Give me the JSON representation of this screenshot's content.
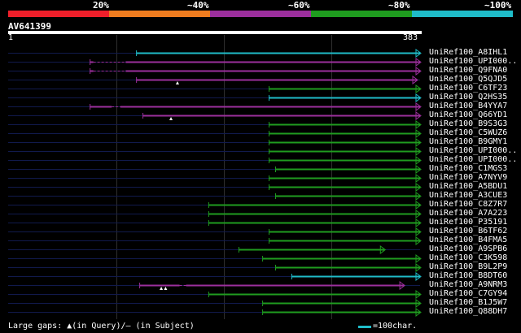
{
  "legend": {
    "labels": [
      "20%",
      "~40%",
      "~60%",
      "~80%",
      "~100%"
    ],
    "colors": [
      "#ef1f2a",
      "#ef7c1f",
      "#9c2f9d",
      "#1f9c1f",
      "#1fbcc9"
    ]
  },
  "query": {
    "title": "AV641399",
    "start_label": "1",
    "end_label": "383",
    "length": 383
  },
  "hits": [
    {
      "name": "UniRef100_A8IHL1",
      "color": "cyan",
      "start": 120,
      "end": 383,
      "gap_start": null,
      "gap_end": null,
      "markers": []
    },
    {
      "name": "UniRef100_UPI000..",
      "color": "purple",
      "start": 77,
      "end": 383,
      "gap_start": 80,
      "gap_end": 110,
      "markers": []
    },
    {
      "name": "UniRef100_Q9FNA0",
      "color": "purple",
      "start": 77,
      "end": 383,
      "gap_start": 80,
      "gap_end": 110,
      "markers": []
    },
    {
      "name": "UniRef100_Q5QJD5",
      "color": "purple",
      "start": 120,
      "end": 380,
      "gap_start": null,
      "gap_end": null,
      "markers": [
        158
      ]
    },
    {
      "name": "UniRef100_C6TF23",
      "color": "green",
      "start": 243,
      "end": 383,
      "gap_start": null,
      "gap_end": null,
      "markers": []
    },
    {
      "name": "UniRef100_Q2HS35",
      "color": "cyan",
      "start": 243,
      "end": 383,
      "gap_start": null,
      "gap_end": null,
      "markers": []
    },
    {
      "name": "UniRef100_B4YYA7",
      "color": "purple",
      "start": 77,
      "end": 383,
      "gap_start": 97,
      "gap_end": 105,
      "markers": []
    },
    {
      "name": "UniRef100_Q66YD1",
      "color": "purple",
      "start": 126,
      "end": 383,
      "gap_start": null,
      "gap_end": null,
      "markers": [
        152
      ]
    },
    {
      "name": "UniRef100_B9S3G3",
      "color": "green",
      "start": 243,
      "end": 383,
      "gap_start": null,
      "gap_end": null,
      "markers": []
    },
    {
      "name": "UniRef100_C5WUZ6",
      "color": "green",
      "start": 243,
      "end": 383,
      "gap_start": null,
      "gap_end": null,
      "markers": []
    },
    {
      "name": "UniRef100_B9GMY1",
      "color": "green",
      "start": 243,
      "end": 383,
      "gap_start": null,
      "gap_end": null,
      "markers": []
    },
    {
      "name": "UniRef100_UPI000..",
      "color": "green",
      "start": 243,
      "end": 383,
      "gap_start": null,
      "gap_end": null,
      "markers": []
    },
    {
      "name": "UniRef100_UPI000..",
      "color": "green",
      "start": 243,
      "end": 383,
      "gap_start": null,
      "gap_end": null,
      "markers": []
    },
    {
      "name": "UniRef100_C1MGS3",
      "color": "green",
      "start": 249,
      "end": 383,
      "gap_start": null,
      "gap_end": null,
      "markers": []
    },
    {
      "name": "UniRef100_A7NYV9",
      "color": "green",
      "start": 243,
      "end": 383,
      "gap_start": null,
      "gap_end": null,
      "markers": []
    },
    {
      "name": "UniRef100_A5BDU1",
      "color": "green",
      "start": 243,
      "end": 383,
      "gap_start": null,
      "gap_end": null,
      "markers": []
    },
    {
      "name": "UniRef100_A3CUE3",
      "color": "green",
      "start": 249,
      "end": 383,
      "gap_start": null,
      "gap_end": null,
      "markers": []
    },
    {
      "name": "UniRef100_C8Z7R7",
      "color": "green",
      "start": 187,
      "end": 383,
      "gap_start": null,
      "gap_end": null,
      "markers": []
    },
    {
      "name": "UniRef100_A7A223",
      "color": "green",
      "start": 187,
      "end": 383,
      "gap_start": null,
      "gap_end": null,
      "markers": []
    },
    {
      "name": "UniRef100_P35191",
      "color": "green",
      "start": 187,
      "end": 383,
      "gap_start": null,
      "gap_end": null,
      "markers": []
    },
    {
      "name": "UniRef100_B6TF62",
      "color": "green",
      "start": 243,
      "end": 383,
      "gap_start": null,
      "gap_end": null,
      "markers": []
    },
    {
      "name": "UniRef100_B4FMA5",
      "color": "green",
      "start": 243,
      "end": 383,
      "gap_start": null,
      "gap_end": null,
      "markers": []
    },
    {
      "name": "UniRef100_A9SPB6",
      "color": "green",
      "start": 215,
      "end": 350,
      "gap_start": null,
      "gap_end": null,
      "markers": []
    },
    {
      "name": "UniRef100_C3K598",
      "color": "green",
      "start": 237,
      "end": 383,
      "gap_start": null,
      "gap_end": null,
      "markers": []
    },
    {
      "name": "UniRef100_B9L2P9",
      "color": "green",
      "start": 249,
      "end": 383,
      "gap_start": null,
      "gap_end": null,
      "markers": []
    },
    {
      "name": "UniRef100_B8DT60",
      "color": "cyan",
      "start": 264,
      "end": 383,
      "gap_start": null,
      "gap_end": null,
      "markers": []
    },
    {
      "name": "UniRef100_A9NRM3",
      "color": "purple",
      "start": 123,
      "end": 368,
      "gap_start": 160,
      "gap_end": 166,
      "markers": [
        143,
        147
      ]
    },
    {
      "name": "UniRef100_C7GY94",
      "color": "green",
      "start": 187,
      "end": 383,
      "gap_start": null,
      "gap_end": null,
      "markers": []
    },
    {
      "name": "UniRef100_B1J5W7",
      "color": "green",
      "start": 237,
      "end": 383,
      "gap_start": null,
      "gap_end": null,
      "markers": []
    },
    {
      "name": "UniRef100_Q88DH7",
      "color": "green",
      "start": 237,
      "end": 383,
      "gap_start": null,
      "gap_end": null,
      "markers": []
    }
  ],
  "footer": {
    "gaps_text": "Large gaps: ▲(in Query)/– (in Subject)",
    "scale_text": "=100char."
  }
}
